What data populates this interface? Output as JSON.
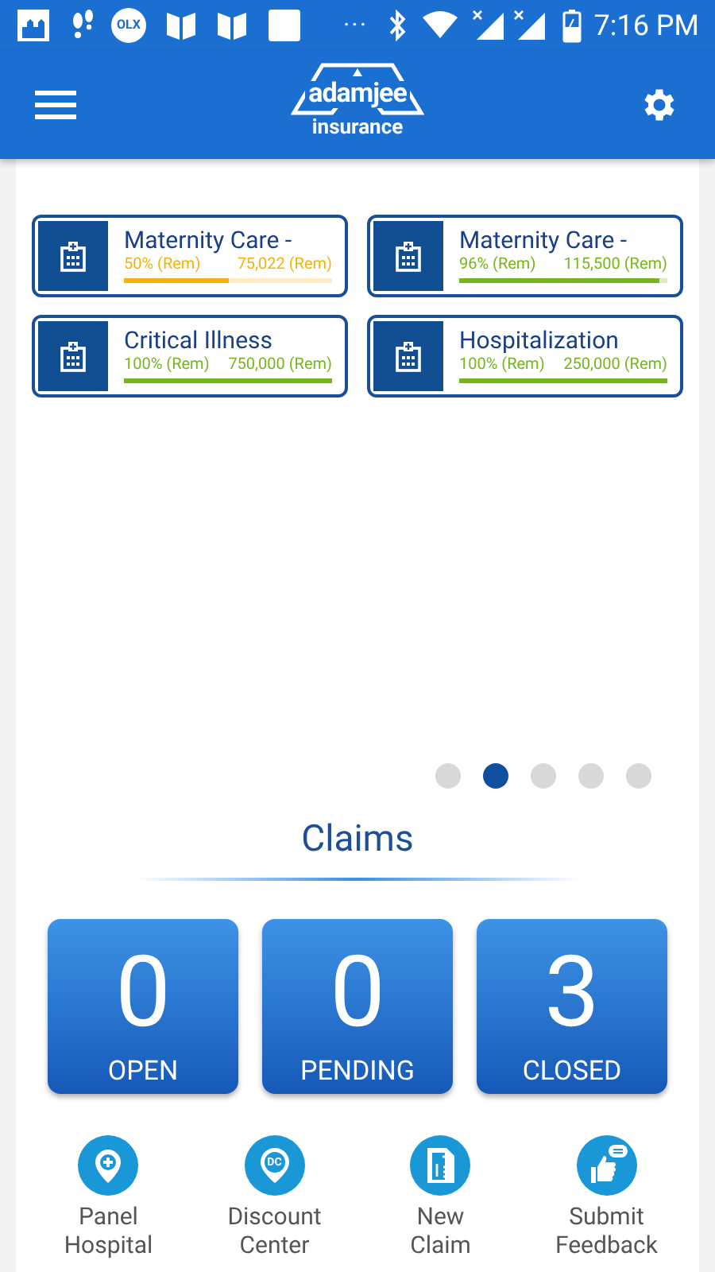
{
  "status_bar": {
    "olx_label": "OLX",
    "overflow": "···",
    "time": "7:16 PM"
  },
  "app_bar": {
    "logo_name": "adamjee",
    "logo_tagline": "insurance"
  },
  "policies": [
    {
      "title": "Maternity Care -",
      "percent": "50% (Rem)",
      "amount": "75,022 (Rem)",
      "level": 0.5,
      "color": "#f5b20f"
    },
    {
      "title": "Maternity Care -",
      "percent": "96% (Rem)",
      "amount": "115,500 (Rem)",
      "level": 0.96,
      "color": "#76b51b"
    },
    {
      "title": "Critical Illness",
      "percent": "100% (Rem)",
      "amount": "750,000 (Rem)",
      "level": 1,
      "color": "#76b51b"
    },
    {
      "title": "Hospitalization",
      "percent": "100% (Rem)",
      "amount": "250,000 (Rem)",
      "level": 1,
      "color": "#76b51b"
    }
  ],
  "pager": [
    {
      "selected": false
    },
    {
      "selected": true
    },
    {
      "selected": false
    },
    {
      "selected": false
    },
    {
      "selected": false
    }
  ],
  "claims": {
    "title": "Claims",
    "tiles": [
      {
        "count": "0",
        "label": "OPEN"
      },
      {
        "count": "0",
        "label": "PENDING"
      },
      {
        "count": "3",
        "label": "CLOSED"
      }
    ]
  },
  "actions": [
    {
      "kind": "hospital",
      "label": [
        "Panel",
        "Hospital"
      ]
    },
    {
      "kind": "discount",
      "label": [
        "Discount",
        "Center"
      ],
      "badge": "DC"
    },
    {
      "kind": "claim",
      "label": [
        "New",
        "Claim"
      ]
    },
    {
      "kind": "feedback",
      "label": [
        "Submit",
        "Feedback"
      ]
    }
  ]
}
